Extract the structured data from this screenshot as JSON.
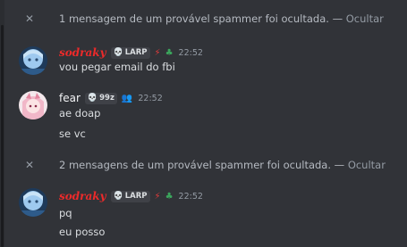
{
  "notices": [
    {
      "text": "1 mensagem de um provável spammer foi ocultada.",
      "dash": " — ",
      "hide_label": "Ocultar"
    },
    {
      "text": "2 mensagens de um provável spammer foi ocultada.",
      "dash": " — ",
      "hide_label": "Ocultar"
    }
  ],
  "messages": [
    {
      "username": "sodraky",
      "tag": "LARP",
      "time": "22:52",
      "lines": [
        "vou pegar email do fbi"
      ]
    },
    {
      "username": "fear",
      "tag": "99z",
      "time": "22:52",
      "lines": [
        "ae doap",
        "se vc"
      ]
    },
    {
      "username": "sodraky",
      "tag": "LARP",
      "time": "22:52",
      "lines": [
        "pq",
        "eu posso"
      ]
    }
  ],
  "icons": {
    "close": "close-icon",
    "skull": "skull-icon",
    "lightning": "lightning-icon",
    "friends": "friends-icon",
    "globe": "globe-icon"
  },
  "colors": {
    "background": "#313338",
    "username_red": "#ec2a2a",
    "muted": "#949ba4"
  }
}
